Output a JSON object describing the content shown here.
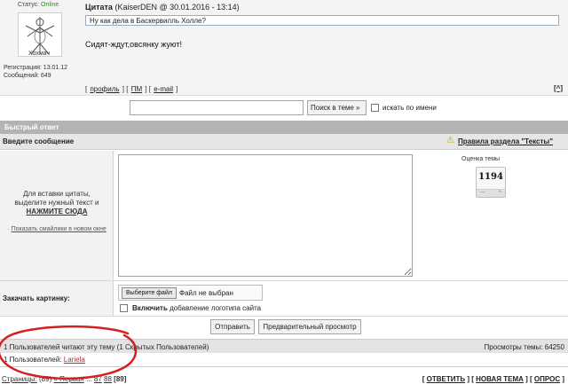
{
  "post": {
    "status_label": "Статус:",
    "status_value": "Online",
    "author_name": "Хохмач",
    "registration": "Регистрация: 13.01.12",
    "messages": "Сообщений: 649",
    "quote_title": "Цитата",
    "quote_meta": "(KaiserDEN @ 30.01.2016 - 13:14)",
    "quote_text": "Ну как дела в Баскервилль Холле?",
    "body_text": "Сидят-ждут,овсянку жуют!",
    "links": {
      "profile": "профиль",
      "pm": "ПМ",
      "email": "e-mail"
    },
    "to_top": "[^]"
  },
  "search": {
    "input_value": "",
    "button_label": "Поиск в теме »",
    "name_checkbox_label": "искать по имени"
  },
  "quick_reply": {
    "title": "Быстрый ответ",
    "message_label": "Введите сообщение",
    "rules_link": "Правила раздела \"Тексты\"",
    "quote_hint_line1": "Для вставки цитаты,",
    "quote_hint_line2": "выделите нужный текст и",
    "quote_hint_action": "НАЖМИТЕ СЮДА",
    "smiles_bullet": "·",
    "smiles_link": "Показать смайлики в новом окне",
    "rating_label": "Оценка темы",
    "rating_value": "1194",
    "rating_minus": "—",
    "rating_plus": "+"
  },
  "upload": {
    "label": "Закачать картинку:",
    "file_button": "Выберите файл",
    "file_status": "Файл не выбран",
    "logo_bold": "Включить",
    "logo_rest": " добавление логотипа сайта"
  },
  "buttons": {
    "send": "Отправить",
    "preview": "Предварительный просмотр"
  },
  "stats": {
    "readers_text": "1 Пользователей читают эту тему (1 Скрытых Пользователей)",
    "views_text": "Просмотры темы: 64250",
    "readers_list_prefix": "1 Пользователей: ",
    "readers_list_user": "Lariela"
  },
  "pager": {
    "label": "Страницы:",
    "count": "(89)",
    "first": "« Первая",
    "ellipsis": "...",
    "page_a": "87",
    "page_b": "88",
    "current": "[89]"
  },
  "actions": {
    "reply": "ОТВЕТИТЬ",
    "new_topic": "НОВАЯ ТЕМА",
    "poll": "ОПРОС"
  },
  "colors": {
    "online": "#2e8b2e",
    "annotation": "#d42020",
    "header_bar": "#b3b3b3"
  }
}
